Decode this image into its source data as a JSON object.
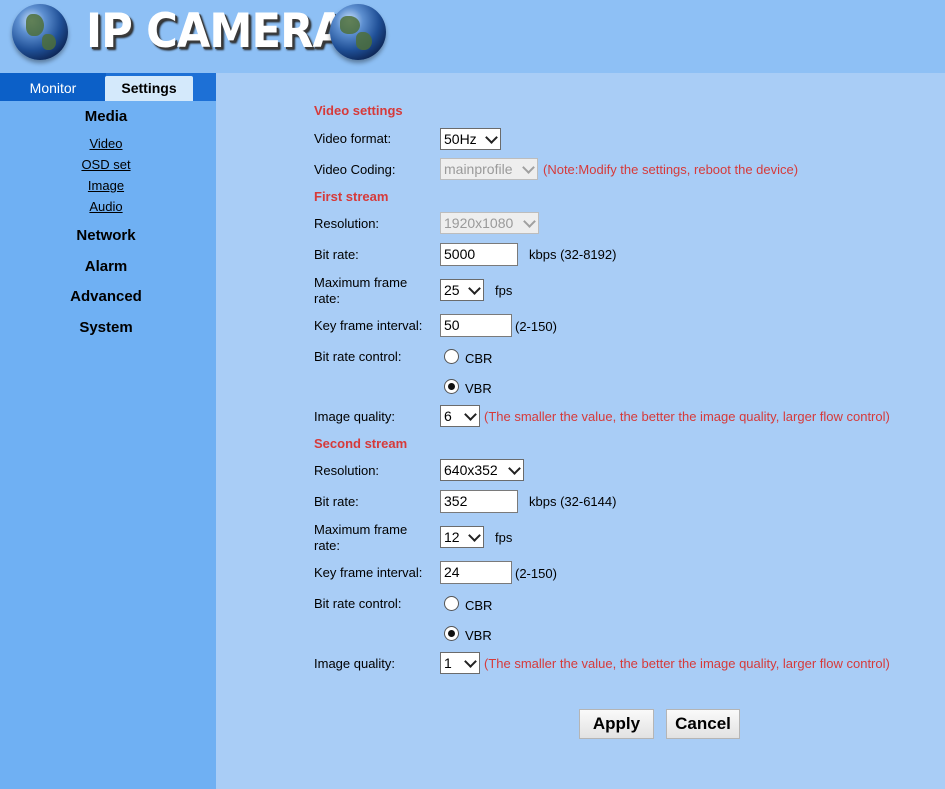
{
  "header": {
    "title": "IP CAMERA"
  },
  "tabs": {
    "monitor": "Monitor",
    "settings": "Settings"
  },
  "sidebar": {
    "media": "Media",
    "media_items": [
      "Video",
      "OSD set",
      "Image",
      "Audio"
    ],
    "network": "Network",
    "alarm": "Alarm",
    "advanced": "Advanced",
    "system": "System"
  },
  "video_settings": {
    "title": "Video settings",
    "format_label": "Video format:",
    "format_value": "50Hz",
    "coding_label": "Video Coding:",
    "coding_value": "mainprofile",
    "coding_note": "(Note:Modify the settings, reboot the device)"
  },
  "first_stream": {
    "title": "First stream",
    "resolution_label": "Resolution:",
    "resolution_value": "1920x1080",
    "bitrate_label": "Bit rate:",
    "bitrate_value": "5000",
    "bitrate_unit": "kbps (32-8192)",
    "maxfps_label_1": "Maximum frame",
    "maxfps_label_2": "rate:",
    "maxfps_value": "25",
    "fps_unit": "fps",
    "keyframe_label": "Key frame interval:",
    "keyframe_value": "50",
    "keyframe_range": "(2-150)",
    "ratecontrol_label": "Bit rate control:",
    "cbr_label": "CBR",
    "vbr_label": "VBR",
    "quality_label": "Image quality:",
    "quality_value": "6",
    "quality_note": "(The smaller the value, the better the image quality, larger flow control)"
  },
  "second_stream": {
    "title": "Second stream",
    "resolution_label": "Resolution:",
    "resolution_value": "640x352",
    "bitrate_label": "Bit rate:",
    "bitrate_value": "352",
    "bitrate_unit": "kbps (32-6144)",
    "maxfps_label_1": "Maximum frame",
    "maxfps_label_2": "rate:",
    "maxfps_value": "12",
    "fps_unit": "fps",
    "keyframe_label": "Key frame interval:",
    "keyframe_value": "24",
    "keyframe_range": "(2-150)",
    "ratecontrol_label": "Bit rate control:",
    "cbr_label": "CBR",
    "vbr_label": "VBR",
    "quality_label": "Image quality:",
    "quality_value": "1",
    "quality_note": "(The smaller the value, the better the image quality, larger flow control)"
  },
  "buttons": {
    "apply": "Apply",
    "cancel": "Cancel"
  }
}
